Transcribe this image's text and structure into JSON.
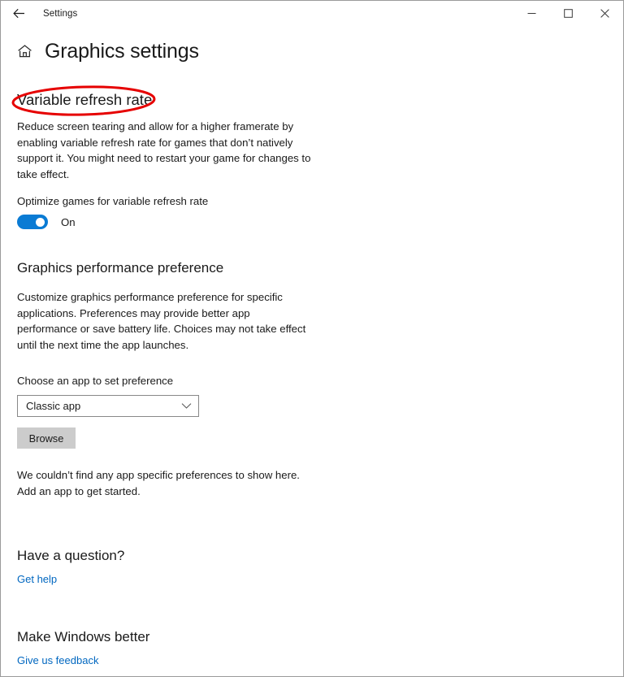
{
  "titlebar": {
    "back_icon": "back-arrow-icon",
    "title": "Settings",
    "minimize_icon": "minimize-icon",
    "maximize_icon": "maximize-icon",
    "close_icon": "close-icon"
  },
  "header": {
    "home_icon": "home-icon",
    "title": "Graphics settings"
  },
  "variable_refresh_rate": {
    "heading": "Variable refresh rate",
    "description": "Reduce screen tearing and allow for a higher framerate by enabling variable refresh rate for games that don’t natively support it. You might need to restart your game for changes to take effect.",
    "toggle_label": "Optimize games for variable refresh rate",
    "toggle_state": "On",
    "toggle_on": true,
    "accent_color": "#0a7bd4"
  },
  "annotation": {
    "shape": "ellipse",
    "color": "#e60000",
    "target": "Variable refresh rate"
  },
  "graphics_performance": {
    "heading": "Graphics performance preference",
    "description": "Customize graphics performance preference for specific applications. Preferences may provide better app performance or save battery life. Choices may not take effect until the next time the app launches.",
    "choose_label": "Choose an app to set preference",
    "dropdown_value": "Classic app",
    "dropdown_icon": "chevron-down-icon",
    "browse_label": "Browse",
    "empty_state": "We couldn’t find any app specific preferences to show here. Add an app to get started."
  },
  "have_a_question": {
    "heading": "Have a question?",
    "link": "Get help",
    "link_color": "#0067c0"
  },
  "make_windows_better": {
    "heading": "Make Windows better",
    "link": "Give us feedback",
    "link_color": "#0067c0"
  }
}
